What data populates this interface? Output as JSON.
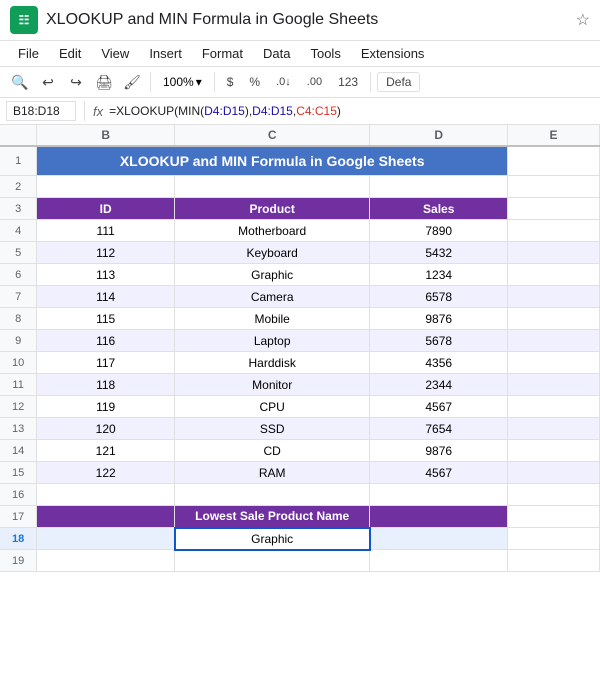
{
  "titleBar": {
    "appIcon": "G",
    "title": "XLOOKUP and MIN Formula in Google Sheets",
    "starLabel": "☆"
  },
  "menuBar": {
    "items": [
      "File",
      "Edit",
      "View",
      "Insert",
      "Format",
      "Data",
      "Tools",
      "Extensions"
    ]
  },
  "toolbar": {
    "zoom": "100%",
    "zoomArrow": "▾",
    "dollarLabel": "$",
    "percentLabel": "%",
    "decDecrLabel": ".0↓",
    "decIncrLabel": ".00",
    "numLabel": "123",
    "fontLabel": "Defa"
  },
  "formulaBar": {
    "cellRef": "B18:D18",
    "fxLabel": "fx",
    "formula": "=XLOOKUP(MIN(D4:D15),D4:D15,C4:C15)"
  },
  "columns": {
    "rowHeader": "",
    "B": "B",
    "C": "C",
    "D": "D",
    "E": "E"
  },
  "rows": [
    {
      "num": "1",
      "b": "XLOOKUP and MIN Formula in Google Sheets",
      "c": "",
      "d": "",
      "type": "title"
    },
    {
      "num": "2",
      "b": "",
      "c": "",
      "d": "",
      "type": "empty"
    },
    {
      "num": "3",
      "b": "ID",
      "c": "Product",
      "d": "Sales",
      "type": "header"
    },
    {
      "num": "4",
      "b": "111",
      "c": "Motherboard",
      "d": "7890",
      "type": "data"
    },
    {
      "num": "5",
      "b": "112",
      "c": "Keyboard",
      "d": "5432",
      "type": "data"
    },
    {
      "num": "6",
      "b": "113",
      "c": "Graphic",
      "d": "1234",
      "type": "data"
    },
    {
      "num": "7",
      "b": "114",
      "c": "Camera",
      "d": "6578",
      "type": "data"
    },
    {
      "num": "8",
      "b": "115",
      "c": "Mobile",
      "d": "9876",
      "type": "data"
    },
    {
      "num": "9",
      "b": "116",
      "c": "Laptop",
      "d": "5678",
      "type": "data"
    },
    {
      "num": "10",
      "b": "117",
      "c": "Harddisk",
      "d": "4356",
      "type": "data"
    },
    {
      "num": "11",
      "b": "118",
      "c": "Monitor",
      "d": "2344",
      "type": "data"
    },
    {
      "num": "12",
      "b": "119",
      "c": "CPU",
      "d": "4567",
      "type": "data"
    },
    {
      "num": "13",
      "b": "120",
      "c": "SSD",
      "d": "7654",
      "type": "data"
    },
    {
      "num": "14",
      "b": "121",
      "c": "CD",
      "d": "9876",
      "type": "data"
    },
    {
      "num": "15",
      "b": "122",
      "c": "RAM",
      "d": "4567",
      "type": "data"
    },
    {
      "num": "16",
      "b": "",
      "c": "",
      "d": "",
      "type": "empty"
    },
    {
      "num": "17",
      "b": "",
      "c": "Lowest  Sale Product Name",
      "d": "",
      "type": "result-header"
    },
    {
      "num": "18",
      "b": "",
      "c": "Graphic",
      "d": "",
      "type": "result-value"
    },
    {
      "num": "19",
      "b": "",
      "c": "",
      "d": "",
      "type": "empty"
    }
  ]
}
